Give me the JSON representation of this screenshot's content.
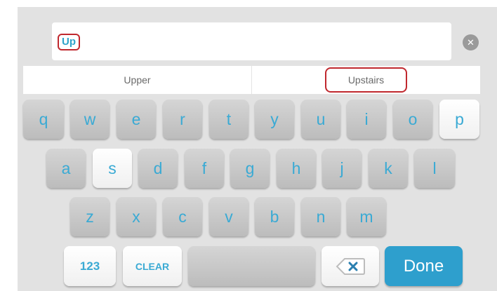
{
  "input": {
    "value": "Up"
  },
  "suggestions": [
    "Upper",
    "Upstairs"
  ],
  "keys": {
    "row1": [
      "q",
      "w",
      "e",
      "r",
      "t",
      "y",
      "u",
      "i",
      "o",
      "p"
    ],
    "row2": [
      "a",
      "s",
      "d",
      "f",
      "g",
      "h",
      "j",
      "k",
      "l"
    ],
    "row3": [
      "z",
      "x",
      "c",
      "v",
      "b",
      "n",
      "m"
    ]
  },
  "bottom": {
    "numbers_label": "123",
    "clear_label": "CLEAR",
    "done_label": "Done"
  },
  "icons": {
    "clear": "circle-x-icon",
    "backspace": "backspace-icon"
  },
  "colors": {
    "accent": "#2ea3c9",
    "done": "#2e9fcd",
    "highlight": "#c0282e"
  }
}
